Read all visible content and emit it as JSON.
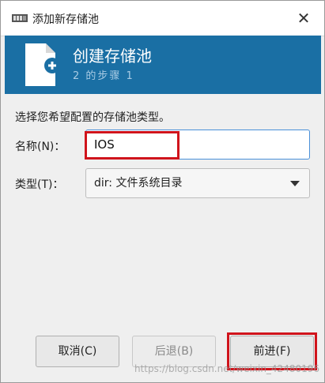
{
  "window": {
    "title": "添加新存储池",
    "close_glyph": "✕",
    "app_icon": "storage-icon"
  },
  "banner": {
    "icon": "document-add-icon",
    "title": "创建存储池",
    "step": "2 的步骤 1",
    "bg_color": "#1a6fa4"
  },
  "form": {
    "prompt": "选择您希望配置的存储池类型。",
    "name_label": "名称(N)：",
    "name_value": "IOS",
    "type_label": "类型(T)：",
    "type_value": "dir: 文件系统目录"
  },
  "buttons": {
    "cancel": "取消(C)",
    "back": "后退(B)",
    "forward": "前进(F)"
  },
  "watermark": "https://blog.csdn.net/weixin_42480196",
  "colors": {
    "highlight": "#d0141c",
    "focus": "#4a90d9"
  }
}
